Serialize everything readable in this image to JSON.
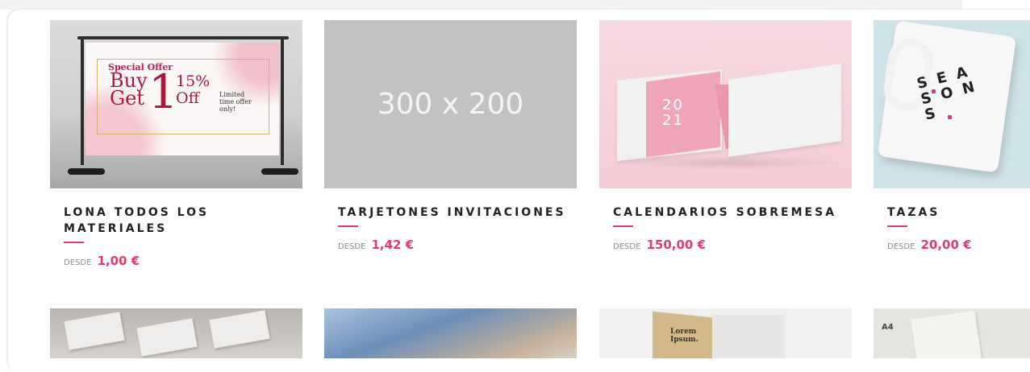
{
  "products": [
    {
      "title": "LONA TODOS LOS MATERIALES",
      "desde": "DESDE",
      "price": "1,00 €"
    },
    {
      "title": "TARJETONES INVITACIONES",
      "desde": "DESDE",
      "price": "1,42 €",
      "placeholder": "300 x 200"
    },
    {
      "title": "CALENDARIOS SOBREMESA",
      "desde": "DESDE",
      "price": "150,00 €"
    },
    {
      "title": "TAZAS",
      "desde": "DESDE",
      "price": "20,00 €"
    }
  ],
  "thumb_text": {
    "banner_special": "Special Offer",
    "banner_buy": "Buy",
    "banner_get": "Get",
    "banner_one": "1",
    "banner_pct": "15%",
    "banner_off": "Off",
    "banner_limited": "Limited time offer only!",
    "calendar_year": "20 21",
    "mug_word": "S E A S O N S",
    "booklet_text": "Lorem Ipsum.",
    "a4_label": "A4"
  },
  "colors": {
    "accent": "#e43b6a",
    "title": "#222222",
    "muted": "#8c8c8c",
    "placeholder_bg": "#c2c2c2"
  }
}
